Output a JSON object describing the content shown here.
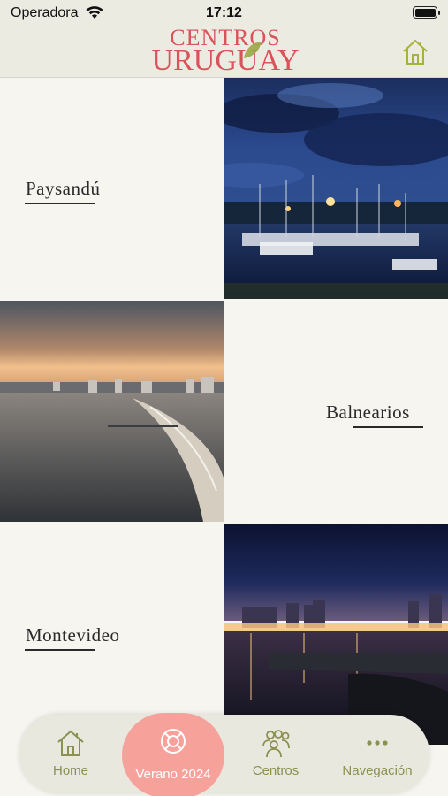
{
  "status_bar": {
    "carrier": "Operadora",
    "time": "17:12"
  },
  "header": {
    "logo_line1": "CENTROS",
    "logo_line2": "URUGUAY",
    "home_icon": "home-outline-icon"
  },
  "grid": {
    "rows": [
      {
        "label": "Paysandú",
        "text_side": "left",
        "photo": "marina-night"
      },
      {
        "label": "Balnearios",
        "text_side": "right",
        "photo": "beach-sunset"
      },
      {
        "label": "Montevideo",
        "text_side": "left",
        "photo": "city-night"
      }
    ]
  },
  "tabbar": {
    "tabs": [
      {
        "label": "Home",
        "icon": "home-icon",
        "active": false
      },
      {
        "label": "Verano 2024",
        "icon": "lifebuoy-icon",
        "active": true
      },
      {
        "label": "Centros",
        "icon": "people-icon",
        "active": false
      },
      {
        "label": "Navegación",
        "icon": "more-dots-icon",
        "active": false
      }
    ]
  },
  "colors": {
    "brand_red": "#d9535a",
    "olive": "#8a9152",
    "active_tab": "#f6a29b",
    "header_bg": "#ecebe2"
  }
}
